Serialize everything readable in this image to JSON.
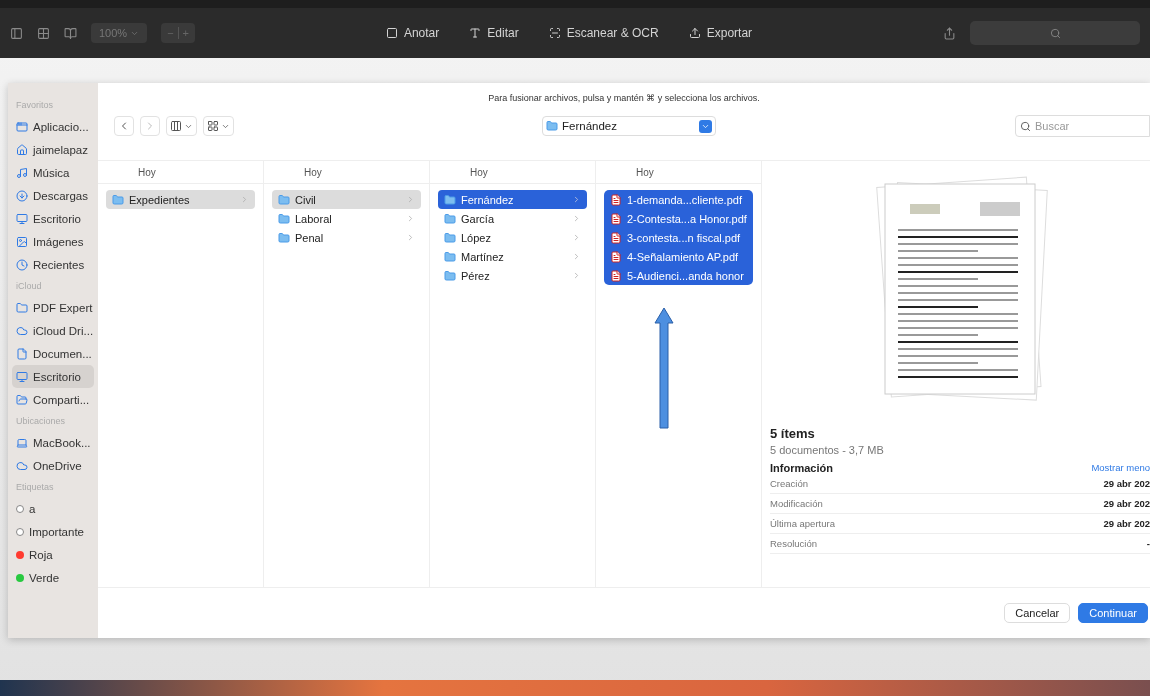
{
  "toolbar": {
    "zoom": "100%",
    "stepper": [
      "−",
      "+"
    ],
    "actions": [
      {
        "label": "Anotar",
        "kind": "annotate"
      },
      {
        "label": "Editar",
        "kind": "edit"
      },
      {
        "label": "Escanear & OCR",
        "kind": "scan"
      },
      {
        "label": "Exportar",
        "kind": "export"
      }
    ]
  },
  "dialog": {
    "hint": "Para fusionar archivos, pulsa y mantén ⌘ y selecciona los archivos.",
    "location": "Fernández",
    "search": {
      "placeholder": "Buscar"
    },
    "sidebar": [
      {
        "title": "Favoritos",
        "items": [
          {
            "label": "Aplicacio...",
            "kind": "apps",
            "selected": false
          },
          {
            "label": "jaimelapaz",
            "kind": "home",
            "selected": false
          },
          {
            "label": "Música",
            "kind": "music",
            "selected": false
          },
          {
            "label": "Descargas",
            "kind": "download",
            "selected": false
          },
          {
            "label": "Escritorio",
            "kind": "desktop",
            "selected": false
          },
          {
            "label": "Imágenes",
            "kind": "images",
            "selected": false
          },
          {
            "label": "Recientes",
            "kind": "clock",
            "selected": false
          }
        ]
      },
      {
        "title": "iCloud",
        "items": [
          {
            "label": "PDF Expert",
            "kind": "folder",
            "selected": false
          },
          {
            "label": "iCloud Dri...",
            "kind": "cloud",
            "selected": false
          },
          {
            "label": "Documen...",
            "kind": "doc",
            "selected": false
          },
          {
            "label": "Escritorio",
            "kind": "desktop",
            "selected": true
          },
          {
            "label": "Comparti...",
            "kind": "shared",
            "selected": false
          }
        ]
      },
      {
        "title": "Ubicaciones",
        "items": [
          {
            "label": "MacBook...",
            "kind": "laptop",
            "selected": false
          },
          {
            "label": "OneDrive",
            "kind": "cloud",
            "selected": false
          }
        ]
      },
      {
        "title": "Etiquetas",
        "items": [
          {
            "label": "a",
            "kind": "tag",
            "color": "#ffffff",
            "selected": false
          },
          {
            "label": "Importante",
            "kind": "tag",
            "color": "#ffffff",
            "selected": false
          },
          {
            "label": "Roja",
            "kind": "tag",
            "color": "#ff3b30",
            "selected": false
          },
          {
            "label": "Verde",
            "kind": "tag",
            "color": "#28c940",
            "selected": false
          }
        ]
      }
    ],
    "columns": [
      {
        "header": "Hoy",
        "focused": false,
        "items": [
          {
            "label": "Expedientes",
            "kind": "folder",
            "selected": true
          }
        ]
      },
      {
        "header": "Hoy",
        "focused": false,
        "items": [
          {
            "label": "Civil",
            "kind": "folder",
            "selected": true
          },
          {
            "label": "Laboral",
            "kind": "folder",
            "selected": false
          },
          {
            "label": "Penal",
            "kind": "folder",
            "selected": false
          }
        ]
      },
      {
        "header": "Hoy",
        "focused": true,
        "items": [
          {
            "label": "Fernández",
            "kind": "folder",
            "selected": true
          },
          {
            "label": "García",
            "kind": "folder",
            "selected": false
          },
          {
            "label": "López",
            "kind": "folder",
            "selected": false
          },
          {
            "label": "Martínez",
            "kind": "folder",
            "selected": false
          },
          {
            "label": "Pérez",
            "kind": "folder",
            "selected": false
          }
        ]
      },
      {
        "header": "Hoy",
        "focused": true,
        "items": [
          {
            "label": "1-demanda...cliente.pdf",
            "kind": "pdf",
            "selected": true
          },
          {
            "label": "2-Contesta...a Honor.pdf",
            "kind": "pdf",
            "selected": true
          },
          {
            "label": "3-contesta...n fiscal.pdf",
            "kind": "pdf",
            "selected": true
          },
          {
            "label": "4-Señalamiento AP.pdf",
            "kind": "pdf",
            "selected": true
          },
          {
            "label": "5-Audienci...anda honor",
            "kind": "pdf",
            "selected": true
          }
        ]
      }
    ],
    "preview": {
      "title": "5 ítems",
      "subtitle": "5 documentos - 3,7 MB",
      "info_title": "Información",
      "toggle": "Mostrar meno",
      "rows": [
        {
          "label": "Creación",
          "value": "29 abr 202"
        },
        {
          "label": "Modificación",
          "value": "29 abr 202"
        },
        {
          "label": "Última apertura",
          "value": "29 abr 202"
        },
        {
          "label": "Resolución",
          "value": "-"
        }
      ]
    },
    "buttons": [
      {
        "label": "Cancelar",
        "kind": "secondary"
      },
      {
        "label": "Continuar",
        "kind": "primary"
      }
    ]
  }
}
